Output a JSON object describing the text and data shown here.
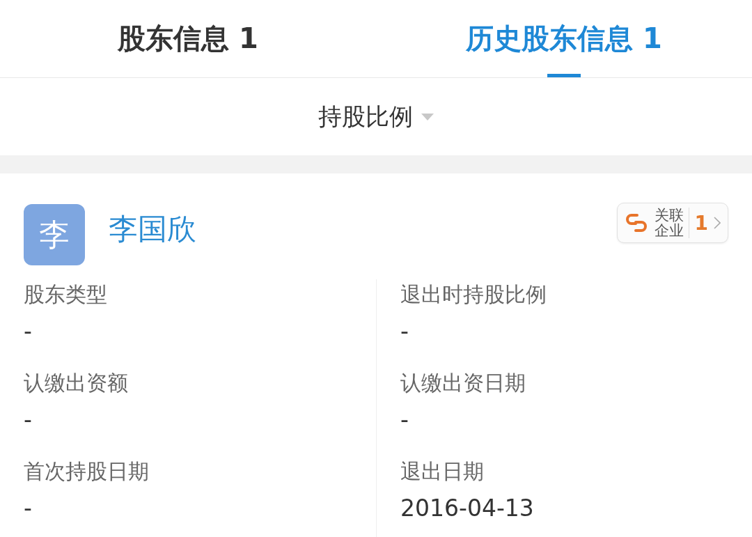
{
  "tabs": [
    {
      "label": "股东信息",
      "count": "1",
      "selected": false
    },
    {
      "label": "历史股东信息",
      "count": "1",
      "selected": true
    }
  ],
  "filter": {
    "label": "持股比例"
  },
  "shareholder": {
    "avatar": "李",
    "name": "李国欣",
    "related": {
      "label": "关联企业",
      "count": "1"
    },
    "fields": [
      {
        "label": "股东类型",
        "value": "-"
      },
      {
        "label": "退出时持股比例",
        "value": "-"
      },
      {
        "label": "认缴出资额",
        "value": "-"
      },
      {
        "label": "认缴出资日期",
        "value": "-"
      },
      {
        "label": "首次持股日期",
        "value": "-"
      },
      {
        "label": "退出日期",
        "value": "2016-04-13"
      }
    ]
  }
}
